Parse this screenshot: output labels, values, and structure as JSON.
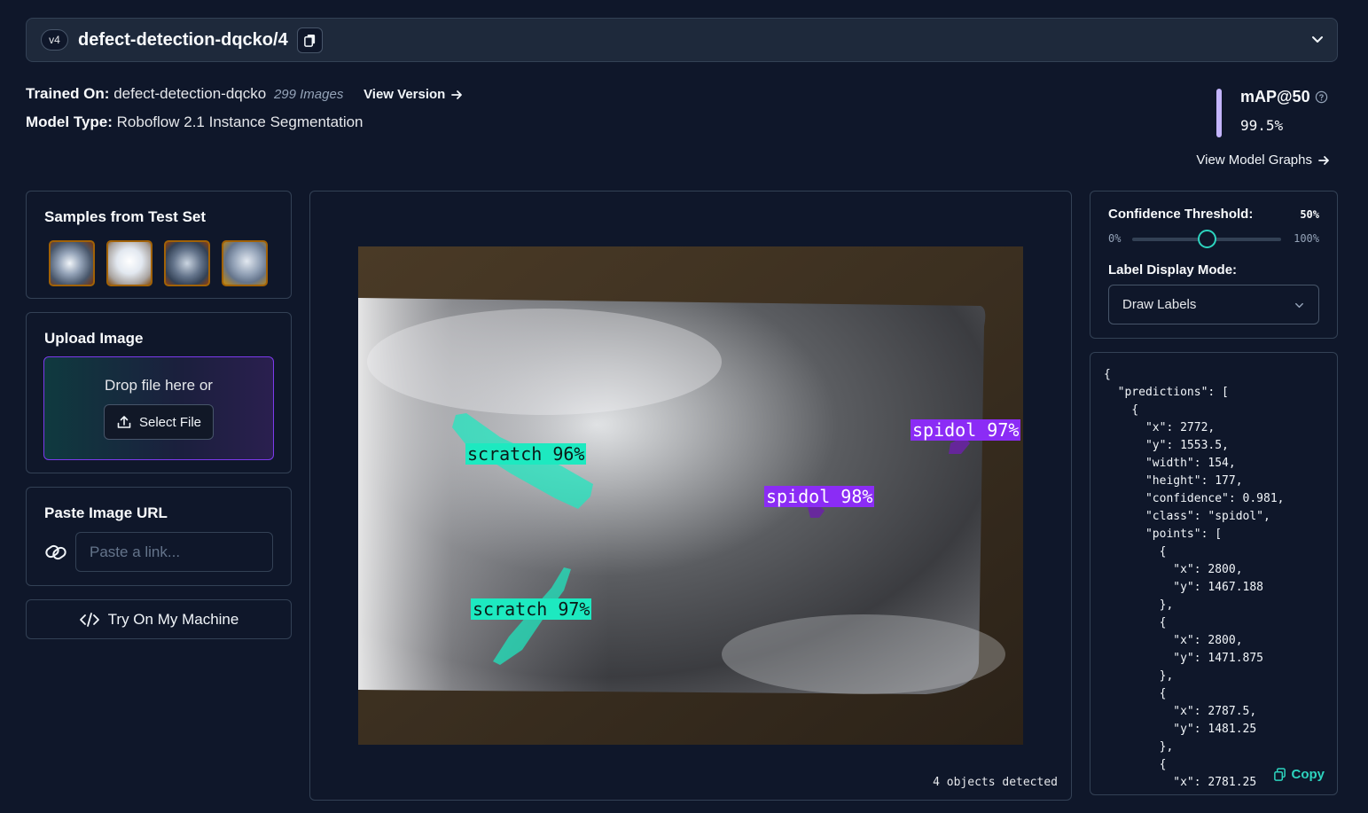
{
  "header": {
    "version_badge": "v4",
    "model_id": "defect-detection-dqcko/4"
  },
  "info": {
    "trained_on_label": "Trained On:",
    "trained_on_value": "defect-detection-dqcko",
    "image_count": "299 Images",
    "view_version": "View Version",
    "model_type_label": "Model Type:",
    "model_type_value": "Roboflow 2.1 Instance Segmentation"
  },
  "metric": {
    "label": "mAP@50",
    "value": "99.5%",
    "view_graphs": "View Model Graphs"
  },
  "samples": {
    "title": "Samples from Test Set",
    "thumbnails": [
      "sample-1",
      "sample-2",
      "sample-3",
      "sample-4"
    ]
  },
  "upload": {
    "title": "Upload Image",
    "drop_text": "Drop file here or",
    "select_file": "Select File"
  },
  "paste_url": {
    "title": "Paste Image URL",
    "placeholder": "Paste a link..."
  },
  "try_machine": "Try On My Machine",
  "detections": [
    {
      "class": "scratch",
      "label": "scratch 96%"
    },
    {
      "class": "scratch",
      "label": "scratch 97%"
    },
    {
      "class": "spidol",
      "label": "spidol 98%"
    },
    {
      "class": "spidol",
      "label": "spidol 97%"
    }
  ],
  "objects_detected": "4 objects detected",
  "controls": {
    "confidence_label": "Confidence Threshold:",
    "confidence_value": "50%",
    "slider_min": "0%",
    "slider_max": "100%",
    "label_mode_label": "Label Display Mode:",
    "label_mode_value": "Draw Labels"
  },
  "json_output": {
    "text": "{\n  \"predictions\": [\n    {\n      \"x\": 2772,\n      \"y\": 1553.5,\n      \"width\": 154,\n      \"height\": 177,\n      \"confidence\": 0.981,\n      \"class\": \"spidol\",\n      \"points\": [\n        {\n          \"x\": 2800,\n          \"y\": 1467.188\n        },\n        {\n          \"x\": 2800,\n          \"y\": 1471.875\n        },\n        {\n          \"x\": 2787.5,\n          \"y\": 1481.25\n        },\n        {\n          \"x\": 2781.25",
    "copy_label": "Copy"
  },
  "colors": {
    "scratch": "#1de9c0",
    "spidol": "#8b2cf5",
    "accent": "#2dd4bf",
    "map_bar": "#c4b5fd"
  }
}
